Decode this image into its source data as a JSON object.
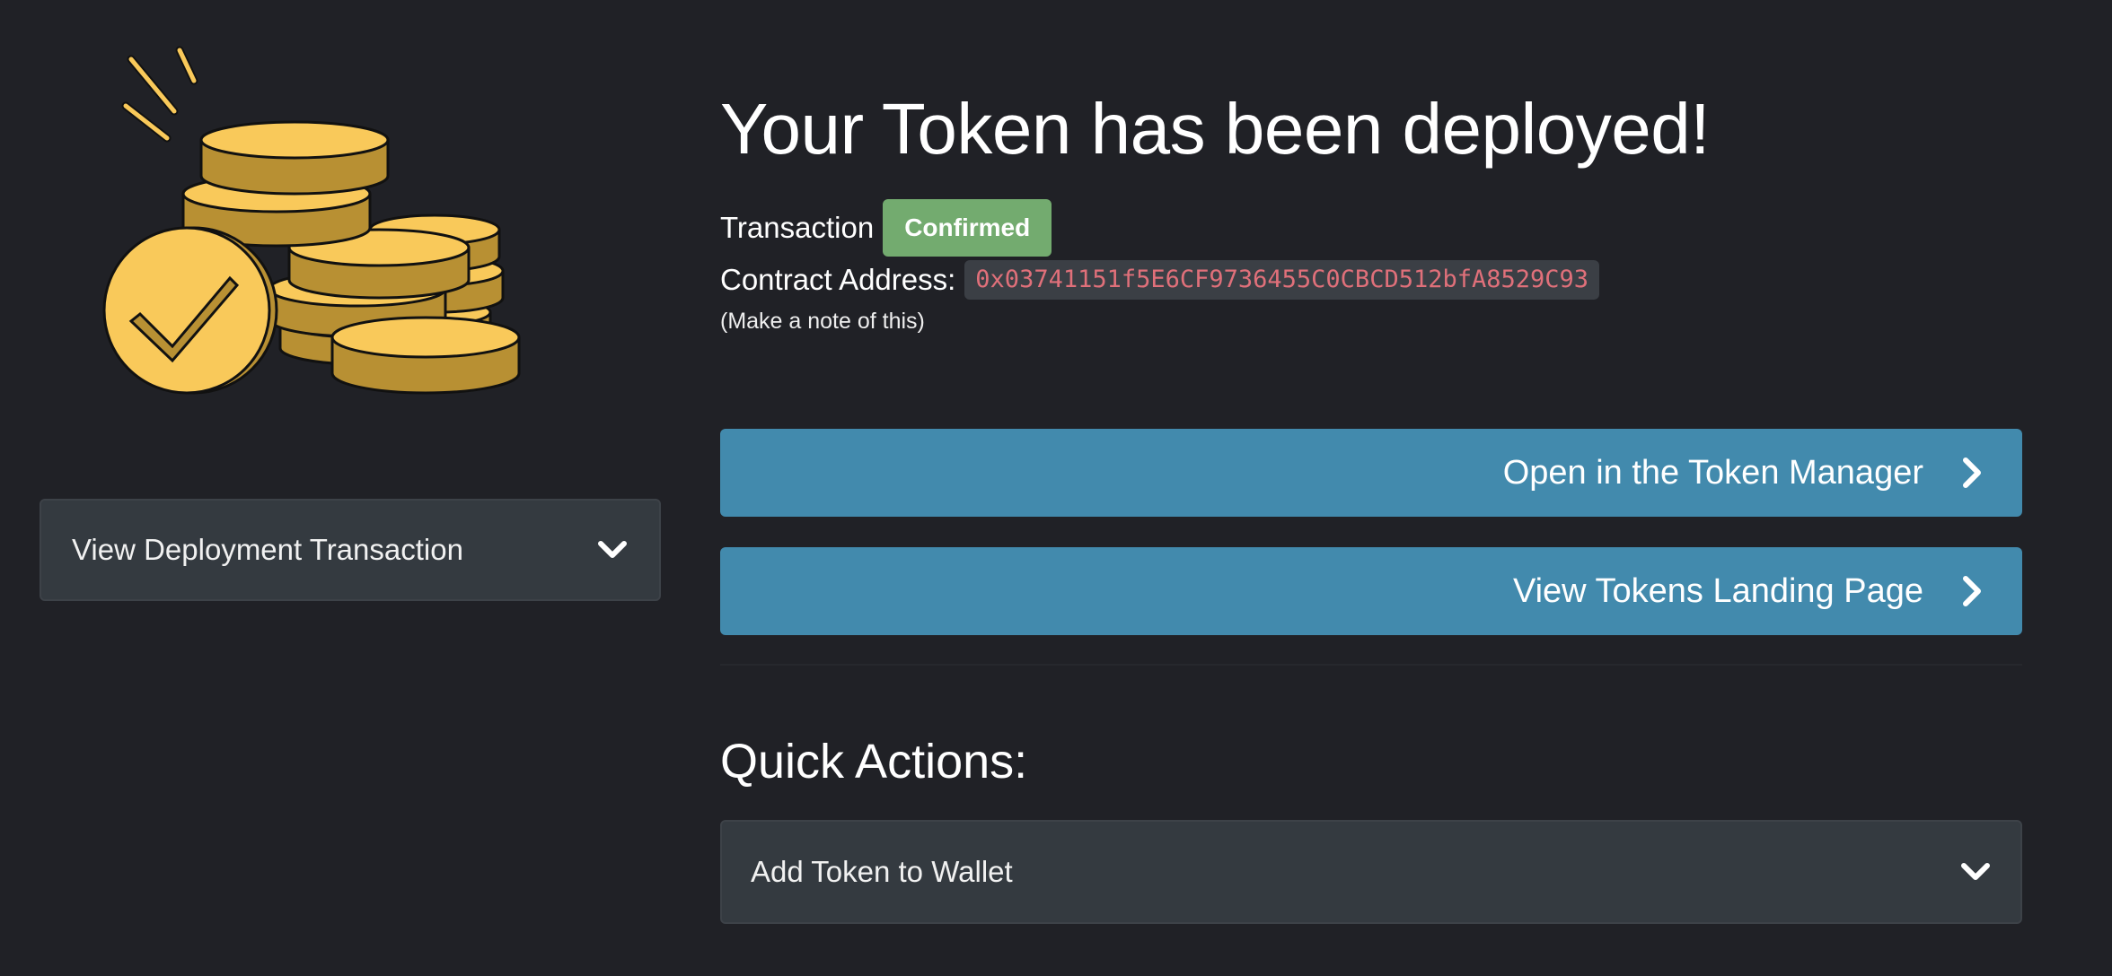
{
  "header": {
    "title": "Your Token has been deployed!"
  },
  "transaction": {
    "label": "Transaction",
    "status": "Confirmed",
    "status_color": "#73ab6f"
  },
  "contract": {
    "label": "Contract Address:",
    "address": "0x03741151f5E6CF9736455C0CBCD512bfA8529C93",
    "address_color": "#e0707a",
    "note": "(Make a note of this)"
  },
  "sidebar": {
    "illustration": "coins-stack-checkmark-icon",
    "deployment_panel": {
      "label": "View Deployment Transaction",
      "icon": "chevron-down-icon"
    }
  },
  "actions": {
    "token_manager": {
      "label": "Open in the Token Manager",
      "icon": "chevron-right-icon"
    },
    "landing_page": {
      "label": "View Tokens Landing Page",
      "icon": "chevron-right-icon"
    },
    "button_color": "#428aad"
  },
  "quick_actions": {
    "title": "Quick Actions:",
    "add_to_wallet": {
      "label": "Add Token to Wallet",
      "icon": "chevron-down-icon"
    }
  }
}
